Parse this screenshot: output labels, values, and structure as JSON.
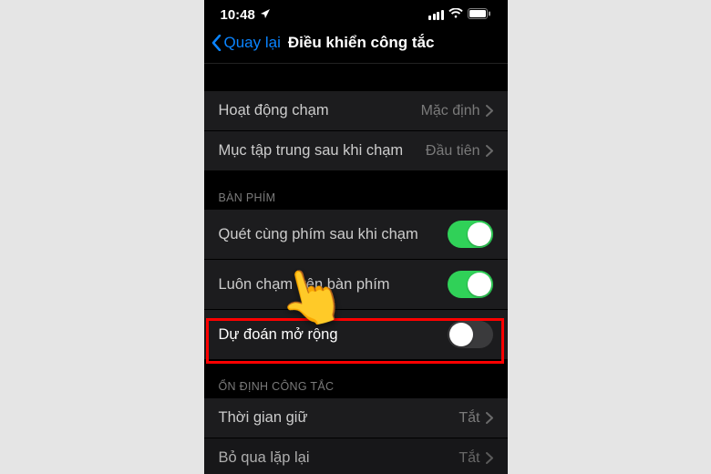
{
  "status": {
    "time": "10:48",
    "nav_glyph": "➤"
  },
  "nav": {
    "back_label": "Quay lại",
    "title": "Điều khiển công tắc"
  },
  "rows": {
    "touch_action": {
      "label": "Hoạt động chạm",
      "value": "Mặc định"
    },
    "focus_after": {
      "label": "Mục tập trung sau khi chạm",
      "value": "Đầu tiên"
    },
    "scan_same_key": {
      "label": "Quét cùng phím sau khi chạm"
    },
    "always_kb": {
      "label": "Luôn chạm trên bàn phím"
    },
    "predict": {
      "label": "Dự đoán mở rộng"
    },
    "hold_time": {
      "label": "Thời gian giữ",
      "value": "Tắt"
    },
    "ignore_repeat": {
      "label": "Bỏ qua lặp lại",
      "value": "Tắt"
    }
  },
  "sections": {
    "keyboard": "BÀN PHÍM",
    "stabilize": "ỔN ĐỊNH CÔNG TẮC"
  },
  "hand_emoji": "👆"
}
